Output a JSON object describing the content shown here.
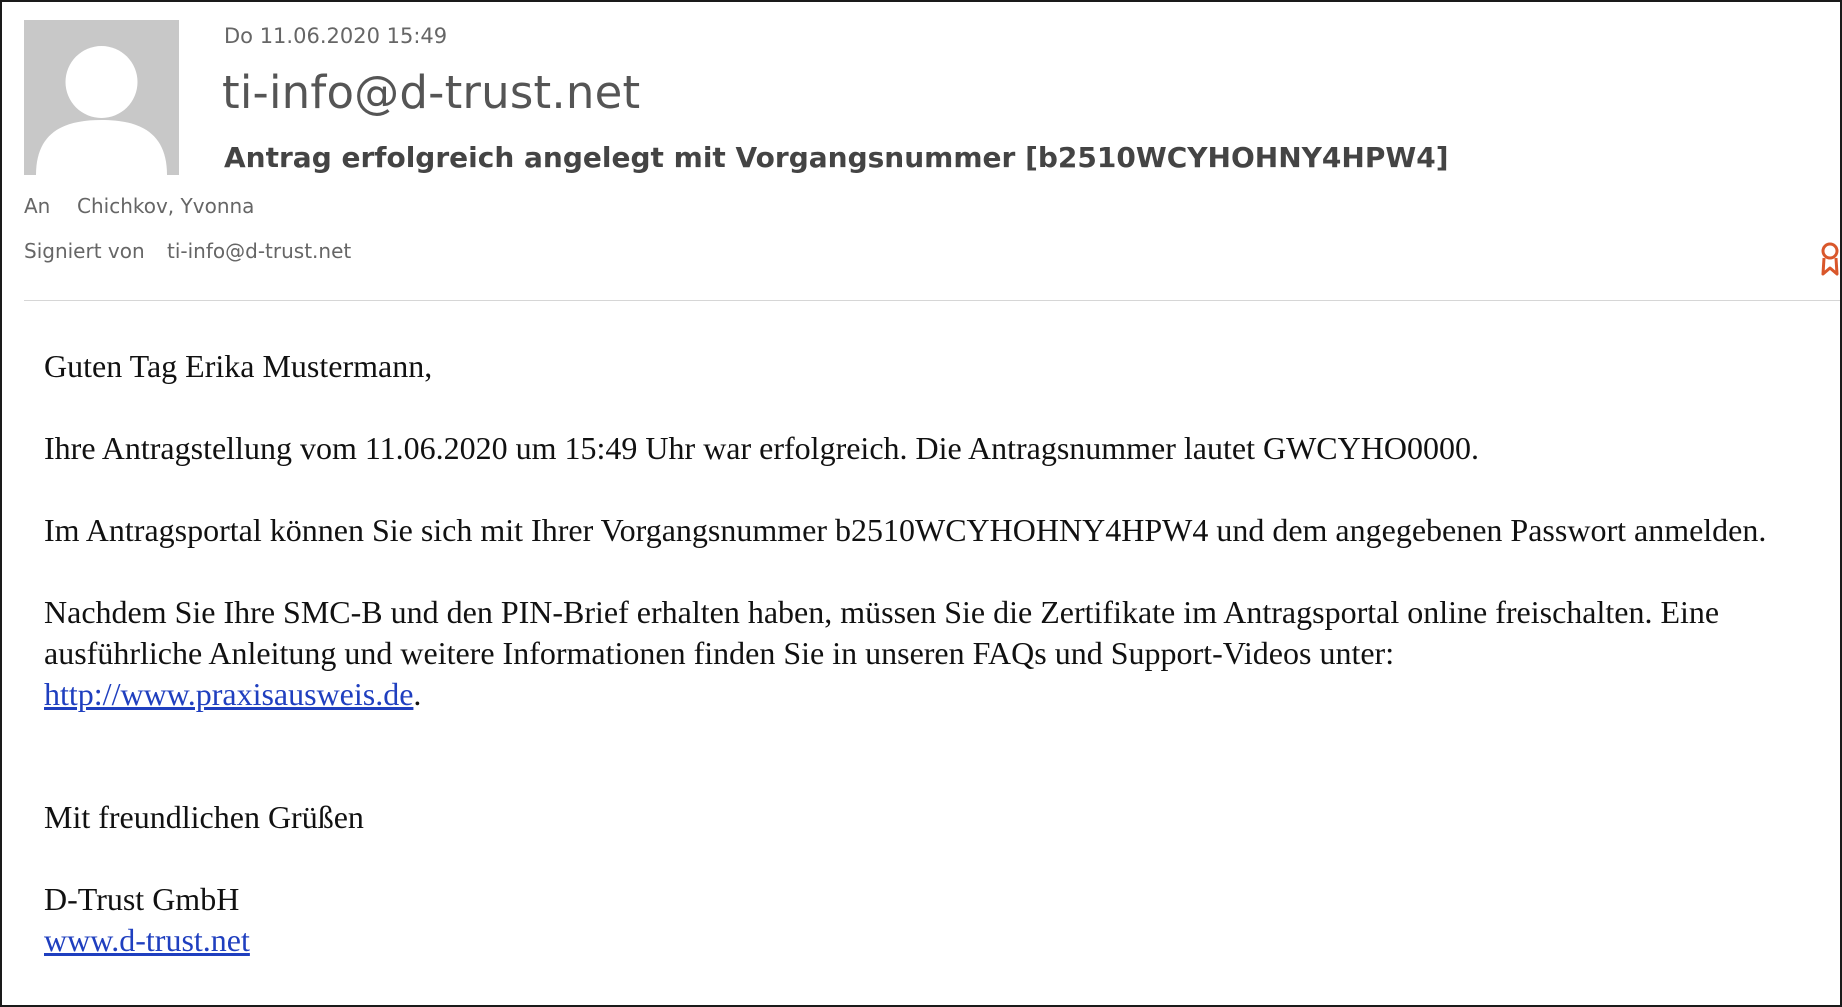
{
  "header": {
    "date": "Do 11.06.2020 15:49",
    "sender": "ti-info@d-trust.net",
    "subject": "Antrag erfolgreich angelegt mit Vorgangsnummer [b2510WCYHOHNY4HPW4]",
    "to_label": "An",
    "to_value": "Chichkov, Yvonna",
    "signed_label": "Signiert von",
    "signed_value": "ti-info@d-trust.net"
  },
  "icons": {
    "avatar": "person-placeholder-icon",
    "certificate": "certificate-ribbon-icon",
    "certificate_color": "#d9572b"
  },
  "body": {
    "greeting": "Guten Tag Erika Mustermann,",
    "para1": "Ihre Antragstellung vom 11.06.2020 um 15:49 Uhr war erfolgreich. Die Antragsnummer lautet GWCYHO0000.",
    "para2": "Im Antragsportal können Sie sich mit Ihrer Vorgangsnummer b2510WCYHOHNY4HPW4 und dem angegebenen Passwort anmelden.",
    "para3": "Nachdem Sie Ihre SMC-B und den PIN-Brief erhalten haben, müssen Sie die Zertifikate im Antragsportal online freischalten. Eine ausführliche Anleitung und weitere Informationen finden Sie in unseren FAQs und Support-Videos unter:",
    "link1": "http://www.praxisausweis.de",
    "link1_suffix": ".",
    "closing": "Mit freundlichen Grüßen",
    "company": "D-Trust GmbH",
    "link2": "www.d-trust.net"
  },
  "colors": {
    "link": "#1f3fbf",
    "avatar_bg": "#c8c8c8"
  }
}
